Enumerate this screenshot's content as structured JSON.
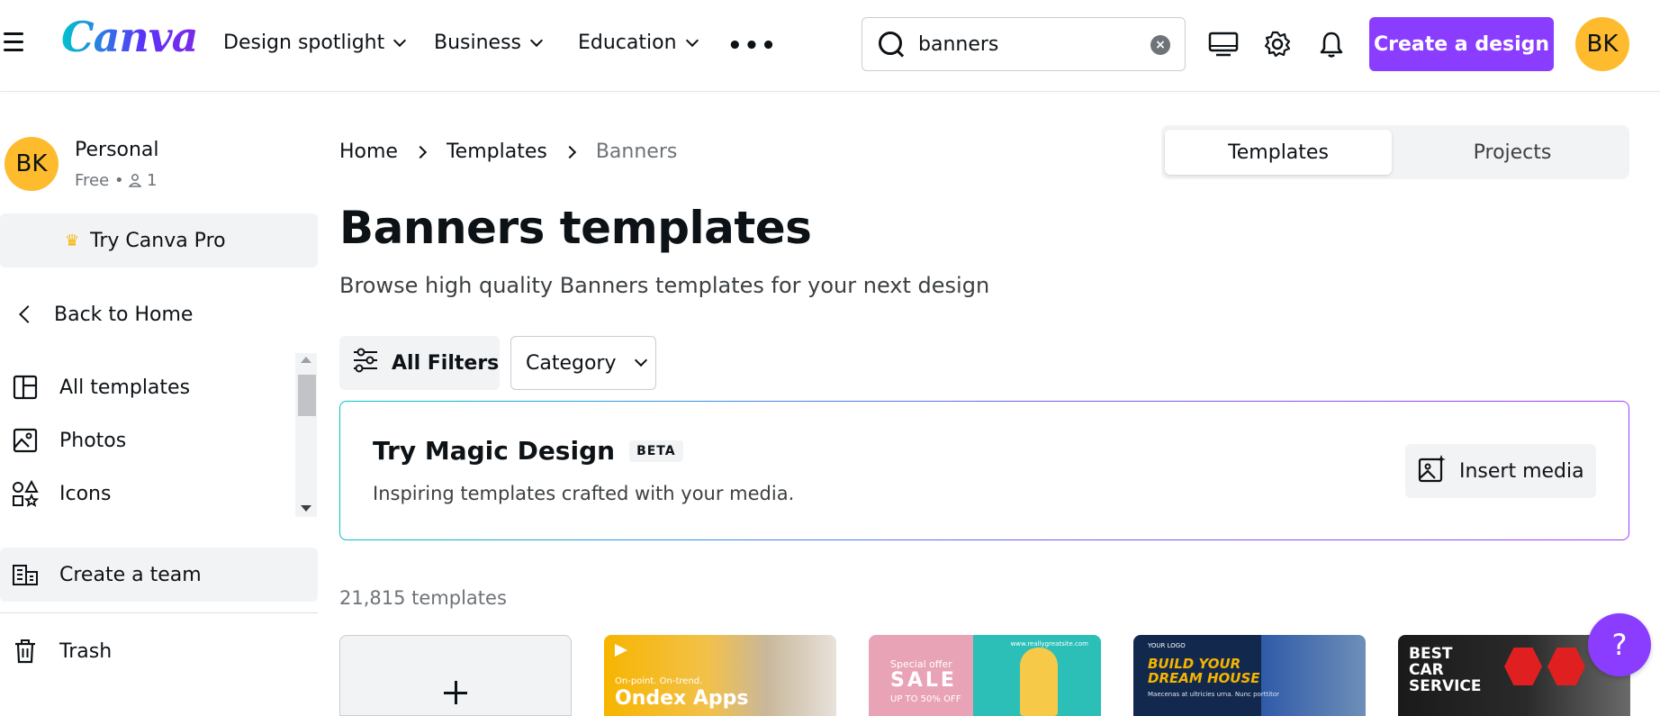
{
  "header": {
    "logo_text": "Canva",
    "nav": [
      {
        "label": "Design spotlight"
      },
      {
        "label": "Business"
      },
      {
        "label": "Education"
      }
    ],
    "more_label": "•••",
    "search": {
      "value": "banners"
    },
    "create_button": "Create a design",
    "avatar_initials": "BK"
  },
  "sidebar": {
    "account": {
      "initials": "BK",
      "name": "Personal",
      "plan": "Free",
      "members": "1"
    },
    "try_pro": "Try Canva Pro",
    "back_home": "Back to Home",
    "items": [
      {
        "label": "All templates",
        "icon": "layout-icon"
      },
      {
        "label": "Photos",
        "icon": "image-icon"
      },
      {
        "label": "Icons",
        "icon": "shapes-icon"
      }
    ],
    "create_team": "Create a team",
    "trash": "Trash"
  },
  "main": {
    "breadcrumb": [
      "Home",
      "Templates",
      "Banners"
    ],
    "toggle": {
      "active": "Templates",
      "inactive": "Projects"
    },
    "title": "Banners templates",
    "subtitle": "Browse high quality Banners templates for your next design",
    "filters_label": "All Filters",
    "category_label": "Category",
    "magic": {
      "title": "Try Magic Design",
      "badge": "BETA",
      "subtitle": "Inspiring templates crafted with your media.",
      "insert_label": "Insert media"
    },
    "count": "21,815 templates",
    "cards": {
      "yellow": {
        "line1": "On-point. On-trend.",
        "line2": "Ondex Apps"
      },
      "sale": {
        "special": "Special offer",
        "sale": "SALE",
        "upto": "UP TO 50% OFF",
        "site": "www.reallygreatsite.com"
      },
      "house": {
        "logo": "YOUR LOGO",
        "headline_1": "BUILD YOUR",
        "headline_2": "DREAM HOUSE",
        "desc": "Maecenas at ultricies urna. Nunc porttitor"
      },
      "car": {
        "line1": "BEST",
        "line2": "CAR",
        "line3": "SERVICE"
      }
    }
  },
  "help_label": "?",
  "colors": {
    "brand_purple": "#8b3dff",
    "avatar_yellow": "#fdbb2d",
    "panel_gray": "#f2f3f5"
  }
}
